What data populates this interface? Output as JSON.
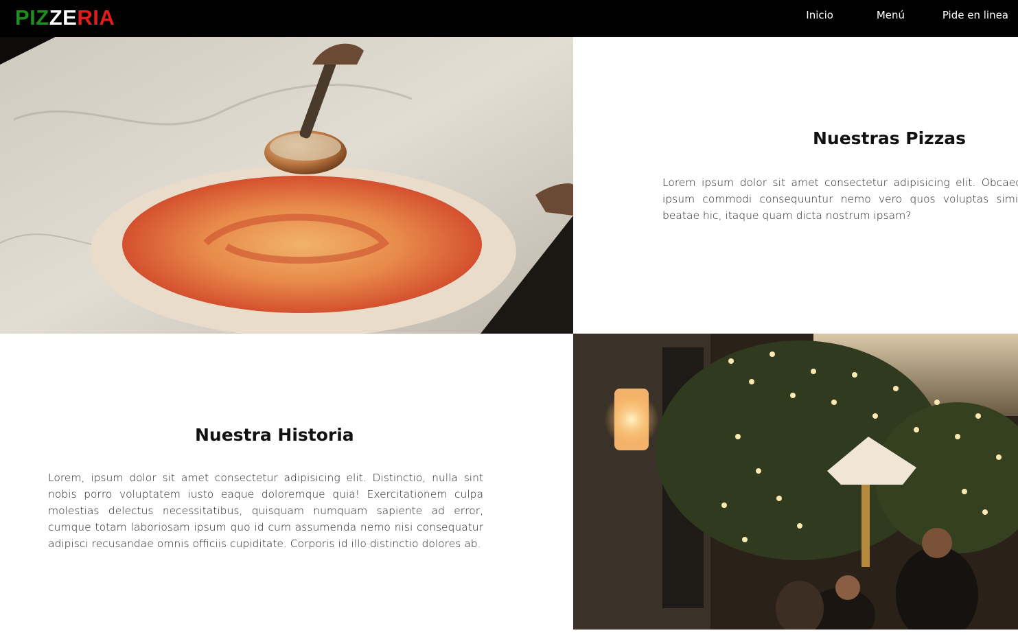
{
  "brand": {
    "letters": [
      {
        "t": "PIZ",
        "c": "g"
      },
      {
        "t": "ZE",
        "c": "w"
      },
      {
        "t": "RIA",
        "c": "r"
      }
    ]
  },
  "nav": {
    "items": [
      "Inicio",
      "Menú",
      "Pide en linea"
    ]
  },
  "pizzas": {
    "title": "Nuestras Pizzas",
    "text": "Lorem ipsum dolor sit amet consectetur adipisicing elit. Obcaecati laborum ut ipsum commodi consequuntur nemo vero quos voluptas similique animi sit beatae hic, itaque quam dicta nostrum ipsam?"
  },
  "historia": {
    "title": "Nuestra Historia",
    "text": "Lorem, ipsum dolor sit amet consectetur adipisicing elit. Distinctio, nulla sint nobis porro voluptatem iusto eaque doloremque quia! Exercitationem culpa molestias delectus necessitatibus, quisquam numquam sapiente ad error, cumque totam laboriosam ipsum quo id cum assumenda nemo nisi consequatur adipisci recusandae omnis officiis cupiditate. Corporis id illo distinctio dolores ab."
  },
  "images": {
    "pizza_photo": "pizza-sauce-photo",
    "street_photo": "restaurant-street-lights-photo"
  },
  "colors": {
    "navbar_bg": "#000000",
    "logo_green": "#1e8e1e",
    "logo_white": "#ffffff",
    "logo_red": "#e31b1b"
  }
}
